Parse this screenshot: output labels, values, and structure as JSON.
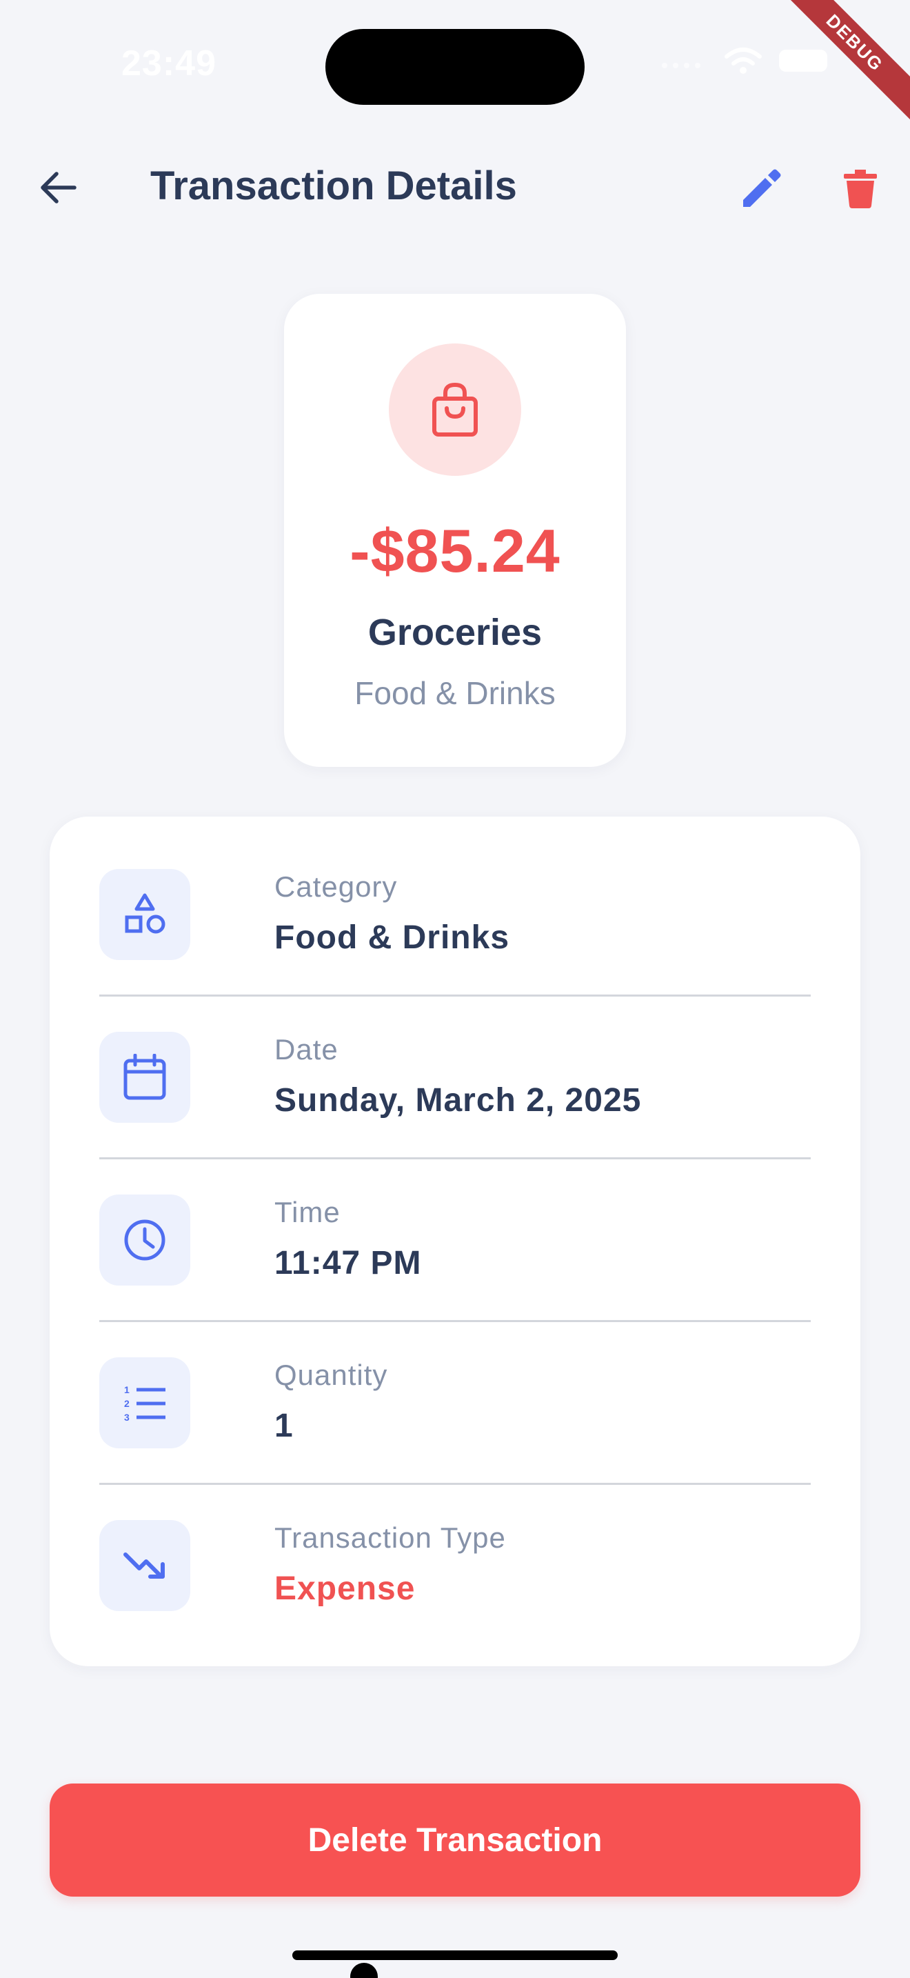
{
  "status_bar": {
    "time": "23:49",
    "debug_label": "DEBUG"
  },
  "app_bar": {
    "title": "Transaction Details",
    "back_icon": "arrow-back-icon",
    "edit_icon": "pencil-edit-icon",
    "delete_icon": "trash-icon"
  },
  "summary": {
    "icon": "shopping-bag-icon",
    "amount": "-$85.24",
    "name": "Groceries",
    "category": "Food & Drinks"
  },
  "details": [
    {
      "icon": "shapes-icon",
      "label": "Category",
      "value": "Food & Drinks"
    },
    {
      "icon": "calendar-icon",
      "label": "Date",
      "value": "Sunday, March 2, 2025"
    },
    {
      "icon": "clock-icon",
      "label": "Time",
      "value": "11:47 PM"
    },
    {
      "icon": "numbered-list-icon",
      "label": "Quantity",
      "value": "1"
    },
    {
      "icon": "trending-down-icon",
      "label": "Transaction Type",
      "value": "Expense"
    }
  ],
  "actions": {
    "delete_button_label": "Delete Transaction"
  },
  "colors": {
    "background": "#f4f5f9",
    "primary_text": "#2c3a58",
    "secondary_text": "#8591a8",
    "accent_blue": "#4f6ef0",
    "expense_red": "#f05252",
    "icon_box": "#edf1fd"
  }
}
